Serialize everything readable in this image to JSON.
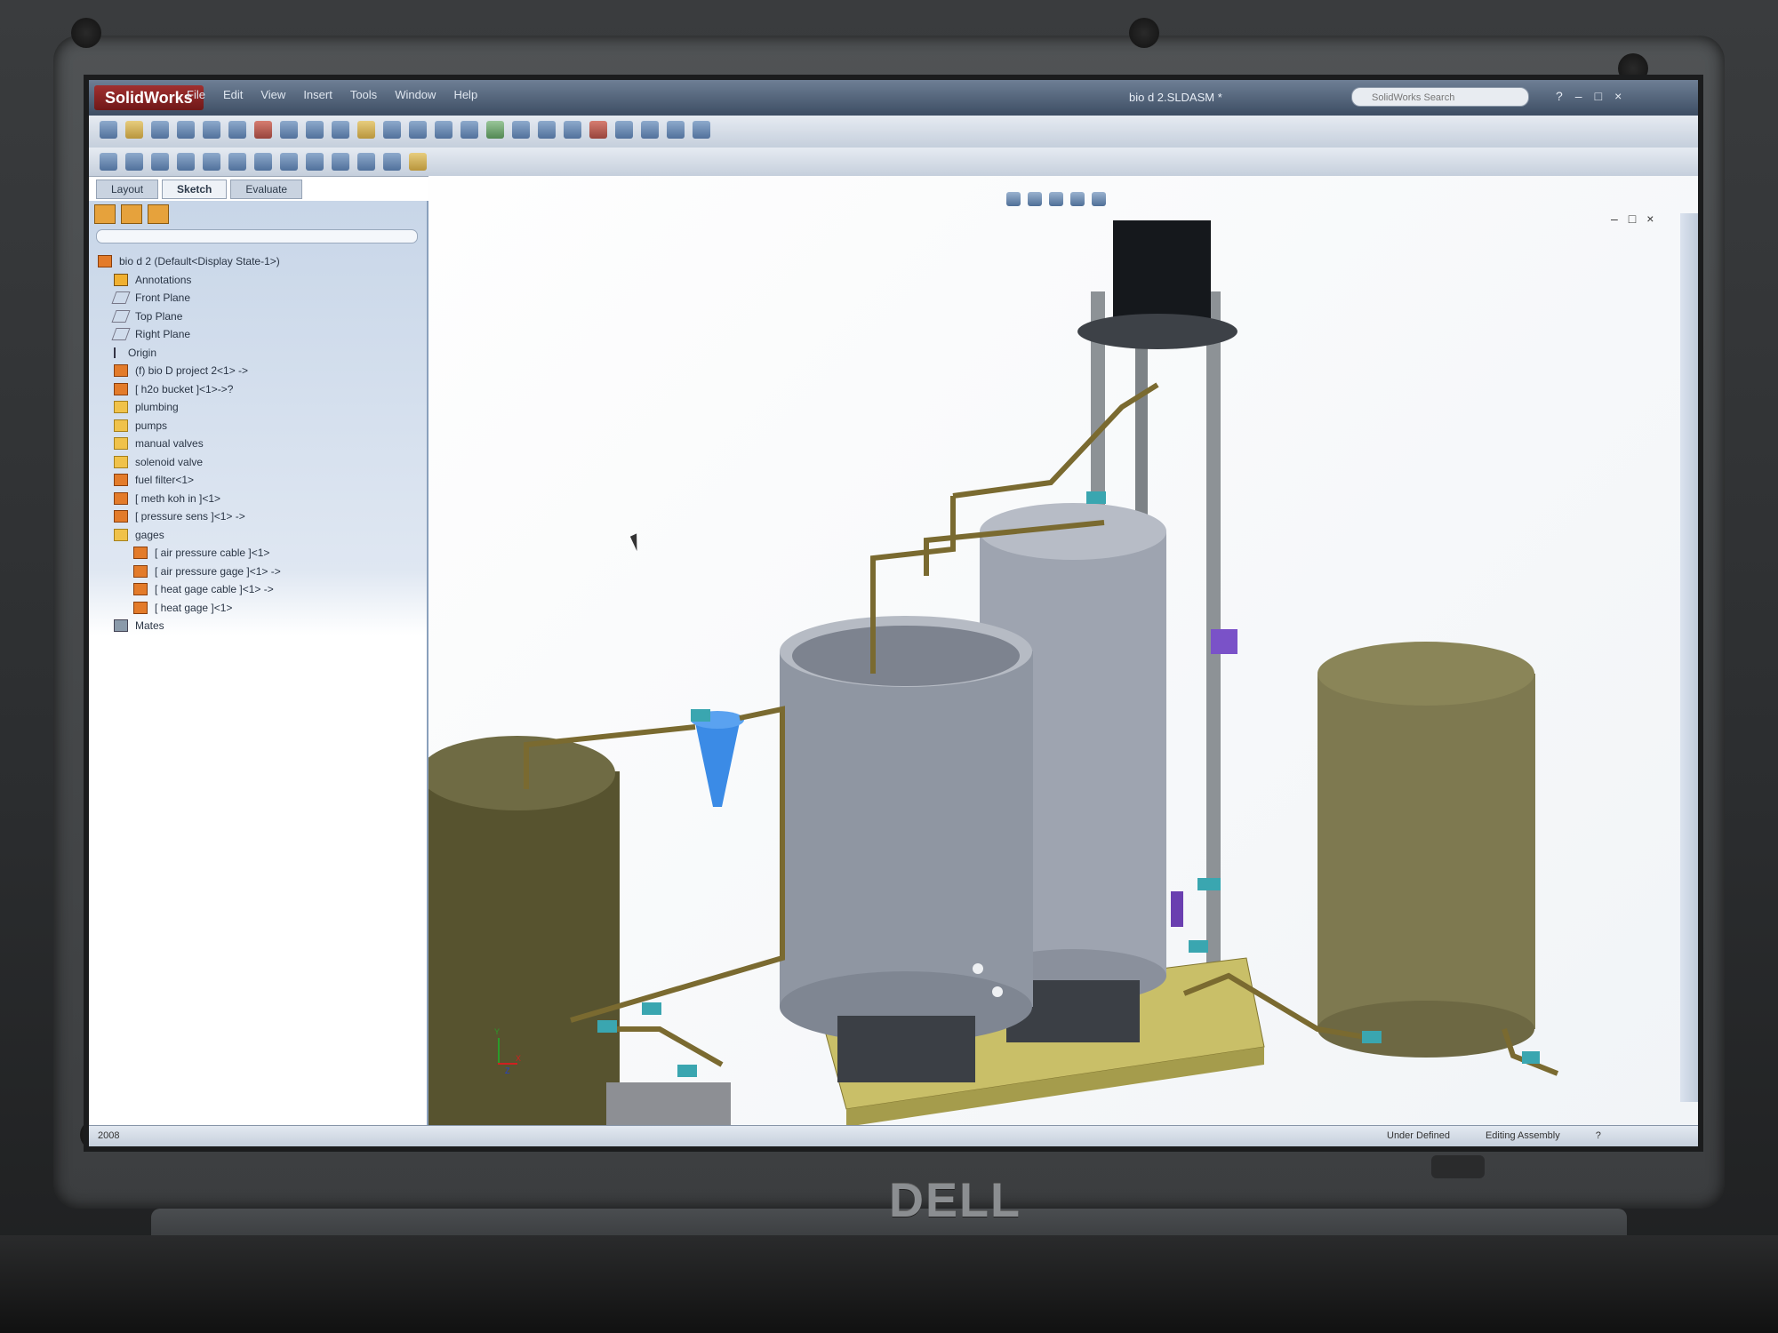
{
  "app": {
    "logo": "SolidWorks",
    "menu": [
      "File",
      "Edit",
      "View",
      "Insert",
      "Tools",
      "Window",
      "Help"
    ],
    "document_title": "bio d 2.SLDASM *",
    "search_placeholder": "SolidWorks Search",
    "window_buttons": [
      "?",
      "–",
      "□",
      "×"
    ]
  },
  "command_tabs": [
    "Layout",
    "Sketch",
    "Evaluate"
  ],
  "feature_tree": {
    "root": "bio d 2  (Default<Display State-1>)",
    "items": [
      {
        "label": "Annotations",
        "icon": "annotations-icon"
      },
      {
        "label": "Front Plane",
        "icon": "plane-icon"
      },
      {
        "label": "Top Plane",
        "icon": "plane-icon"
      },
      {
        "label": "Right Plane",
        "icon": "plane-icon"
      },
      {
        "label": "Origin",
        "icon": "origin-icon"
      },
      {
        "label": "(f) bio D project 2<1> ->",
        "icon": "part-icon"
      },
      {
        "label": "[ h2o bucket ]<1>->?",
        "icon": "part-icon"
      },
      {
        "label": "plumbing",
        "icon": "folder-icon"
      },
      {
        "label": "pumps",
        "icon": "folder-icon"
      },
      {
        "label": "manual valves",
        "icon": "folder-icon"
      },
      {
        "label": "solenoid valve",
        "icon": "folder-icon"
      },
      {
        "label": "fuel filter<1>",
        "icon": "part-icon"
      },
      {
        "label": "[ meth koh in ]<1>",
        "icon": "part-icon"
      },
      {
        "label": "[ pressure sens ]<1> ->",
        "icon": "part-icon"
      },
      {
        "label": "gages",
        "icon": "folder-icon"
      }
    ],
    "gages_children": [
      "[ air pressure cable ]<1>",
      "[ air pressure gage ]<1> ->",
      "[ heat gage cable ]<1> ->",
      "[ heat gage ]<1>"
    ],
    "mates": "Mates"
  },
  "status_bar": {
    "left": "2008",
    "under_defined": "Under Defined",
    "editing": "Editing Assembly",
    "help": "?"
  },
  "axis_triad": {
    "x": "X",
    "y": "Y",
    "z": "Z"
  },
  "brand": "DELL",
  "colors": {
    "tank_gray": "#9ea4b0",
    "tank_olive": "#6f6b44",
    "tank_olive_light": "#8a8558",
    "pipe": "#7a6a30",
    "valve": "#3aa6b0",
    "base_tray": "#c9bf68",
    "filter_blue": "#3b8be6"
  }
}
